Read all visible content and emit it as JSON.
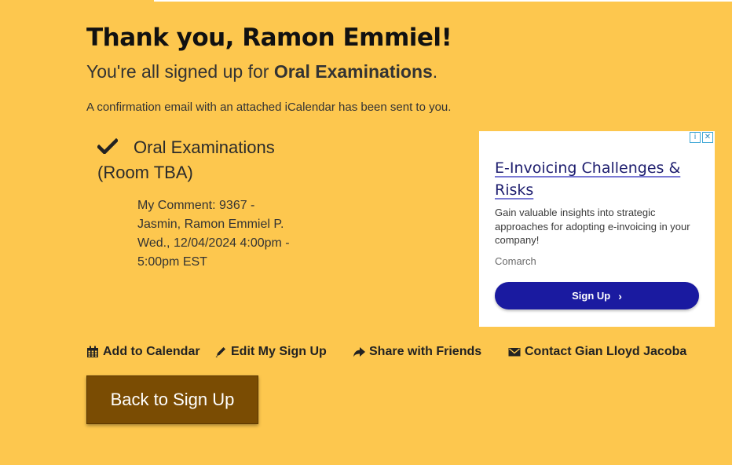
{
  "header": {
    "title": "Thank you, Ramon Emmiel!",
    "signed_prefix": "You're all signed up for ",
    "event_name": "Oral Examinations",
    "signed_suffix": ".",
    "confirmation": "A confirmation email with an attached iCalendar has been sent to you."
  },
  "slot": {
    "icon": "check-icon",
    "title": "Oral Examinations (Room TBA)",
    "comment": "My Comment: 9367 - Jasmin, Ramon Emmiel P.",
    "datetime": "Wed., 12/04/2024 4:00pm - 5:00pm EST"
  },
  "ad": {
    "title": "E-Invoicing Challenges & Risks",
    "description": "Gain valuable insights into strategic approaches for adopting e-invoicing in your company!",
    "brand": "Comarch",
    "cta": "Sign Up",
    "cta_color": "#1a1aa0"
  },
  "actions": {
    "add_calendar": "Add to Calendar",
    "edit_signup": "Edit My Sign Up",
    "share": "Share with Friends",
    "contact": "Contact Gian Lloyd Jacoba"
  },
  "back_button": "Back to Sign Up",
  "colors": {
    "background": "#fdc74e",
    "button": "#7a4c03"
  }
}
